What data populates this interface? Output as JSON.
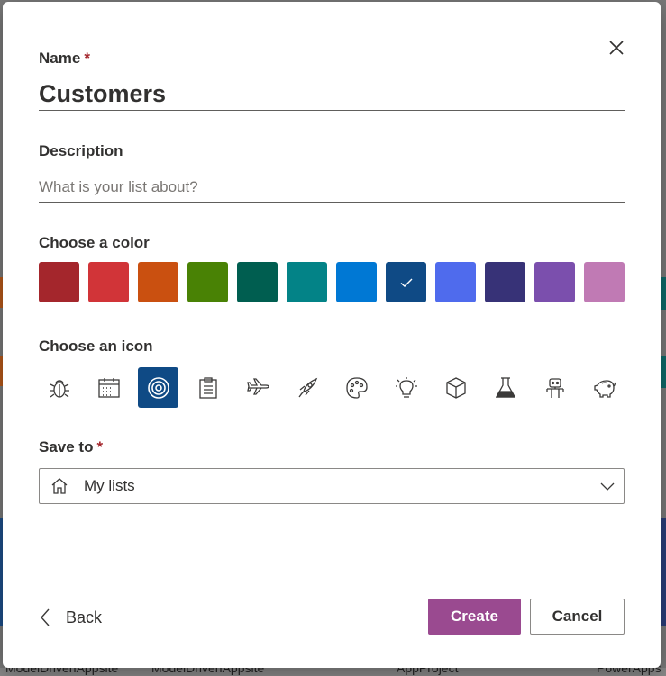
{
  "backdrop": {
    "fragments": [
      "ModelDrivenAppsite",
      "ModelDrivenAppsite",
      "AppProject",
      "PowerApps"
    ]
  },
  "dialog": {
    "close_icon": "close-icon",
    "name": {
      "label": "Name",
      "required_mark": "*",
      "value": "Customers"
    },
    "description": {
      "label": "Description",
      "placeholder": "What is your list about?",
      "value": ""
    },
    "color": {
      "label": "Choose a color",
      "swatches": [
        "#a4262c",
        "#d13438",
        "#ca5010",
        "#498205",
        "#005e50",
        "#038387",
        "#0078d4",
        "#0f4a85",
        "#4f6bed",
        "#373277",
        "#7b4fad",
        "#c07ab4"
      ],
      "selected_index": 7,
      "check_icon": "checkmark-icon"
    },
    "icon": {
      "label": "Choose an icon",
      "icons": [
        "bug-icon",
        "calendar-icon",
        "target-icon",
        "clipboard-icon",
        "airplane-icon",
        "rocket-icon",
        "palette-icon",
        "lightbulb-icon",
        "cube-icon",
        "flask-icon",
        "robot-icon",
        "piggy-bank-icon"
      ],
      "selected_index": 2
    },
    "save_to": {
      "label": "Save to",
      "required_mark": "*",
      "value": "My lists",
      "icon": "home-icon",
      "chevron": "chevron-down-icon"
    },
    "back": {
      "label": "Back",
      "icon": "chevron-left-icon"
    },
    "create": {
      "label": "Create"
    },
    "cancel": {
      "label": "Cancel"
    },
    "accent": "#9a4a90"
  }
}
